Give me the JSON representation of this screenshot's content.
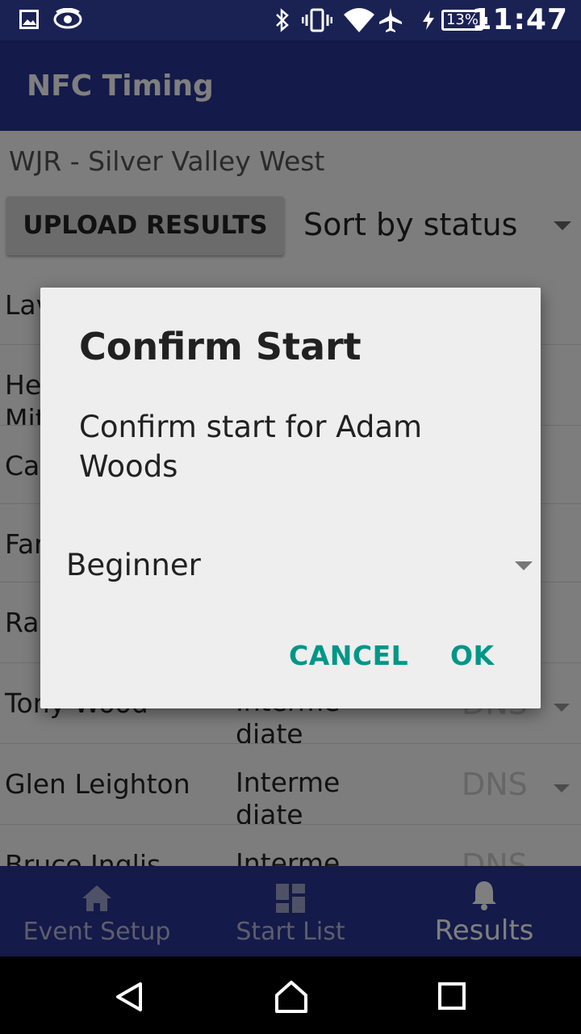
{
  "status_bar": {
    "time": "11:47",
    "battery": "13%",
    "icons": [
      "image-icon",
      "eye-icon",
      "bluetooth-icon",
      "vibrate-icon",
      "wifi-icon",
      "airplane-icon",
      "charging-icon"
    ]
  },
  "app_bar": {
    "title": "NFC Timing"
  },
  "event": {
    "name": "WJR - Silver Valley West"
  },
  "toolbar": {
    "upload_label": "UPLOAD RESULTS",
    "sort_value": "Sort by status"
  },
  "rows": [
    {
      "name": "Lav",
      "level": "",
      "status": ""
    },
    {
      "name": "He",
      "name2": "Mit",
      "level": "",
      "status": ""
    },
    {
      "name": "Cat",
      "level": "",
      "status": ""
    },
    {
      "name": "Far",
      "level": "",
      "status": ""
    },
    {
      "name": "Rac",
      "level": "",
      "status": ""
    },
    {
      "name": "Tony Wood",
      "level": "Interme diate",
      "status": "DNS"
    },
    {
      "name": "Glen Leighton",
      "level": "Interme diate",
      "status": "DNS"
    },
    {
      "name": "Bruce Inglis",
      "level": "Interme",
      "status": "DNS"
    }
  ],
  "bottom_nav": {
    "tabs": [
      {
        "label": "Event Setup",
        "icon": "home-icon"
      },
      {
        "label": "Start List",
        "icon": "dashboard-icon"
      },
      {
        "label": "Results",
        "icon": "bell-icon"
      }
    ],
    "active": "Results"
  },
  "dialog": {
    "title": "Confirm Start",
    "message": "Confirm start for Adam Woods",
    "category": "Beginner",
    "cancel_label": "CANCEL",
    "ok_label": "OK"
  },
  "colors": {
    "primary": "#283593",
    "status_bar": "#1a2254",
    "accent": "#009688"
  }
}
